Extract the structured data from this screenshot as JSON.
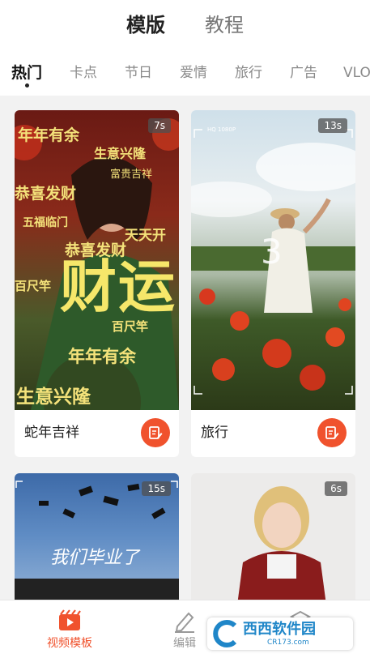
{
  "top_tabs": {
    "active": "模版",
    "inactive": "教程"
  },
  "categories": [
    "热门",
    "卡点",
    "节日",
    "爱情",
    "旅行",
    "广告",
    "VLO"
  ],
  "cards": [
    {
      "title": "蛇年吉祥",
      "duration": "7s"
    },
    {
      "title": "旅行",
      "duration": "13s"
    },
    {
      "title": "",
      "duration": "15s"
    },
    {
      "title": "",
      "duration": "6s"
    }
  ],
  "card1_overlay": {
    "lines": [
      "年年有余",
      "生意兴隆",
      "恭喜发财",
      "天天开",
      "恭喜发财",
      "财运",
      "年年有余",
      "生意兴隆",
      "五福临门",
      "百尺竿",
      "富贵吉祥",
      "百尺竿"
    ]
  },
  "card2_overlay": {
    "rec": "HQ 1080P",
    "digit": "3"
  },
  "card3_overlay": {
    "script": "我们毕业了"
  },
  "bottom_nav": [
    {
      "label": "视频模板",
      "icon": "video-template-icon",
      "active": true
    },
    {
      "label": "编辑",
      "icon": "pencil-icon",
      "active": false
    },
    {
      "label": "",
      "icon": "template-icon",
      "active": false
    }
  ],
  "watermark": {
    "text": "西西软件园",
    "sub": "CR173.com"
  },
  "colors": {
    "accent": "#f0522d",
    "active_nav": "#f0522d"
  }
}
